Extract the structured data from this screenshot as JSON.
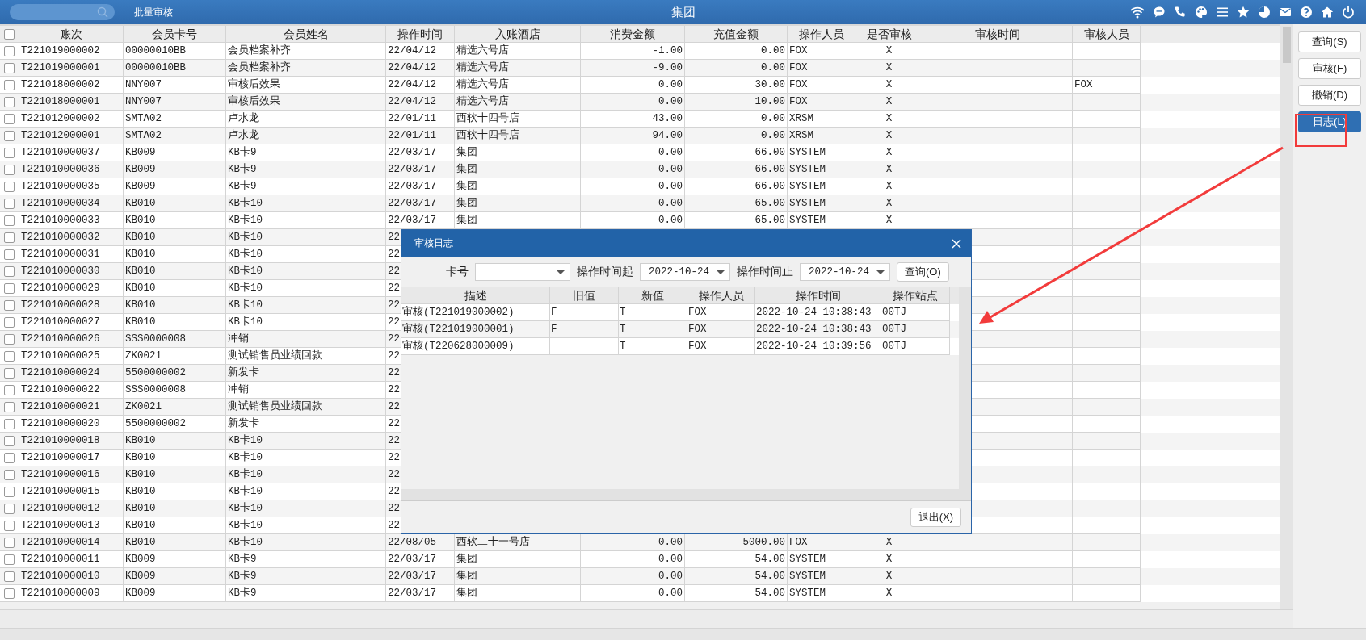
{
  "top_bar": {
    "module_label": "批量审核",
    "title": "集团"
  },
  "table": {
    "header_checkbox": {
      "checked": false
    },
    "columns": [
      "账次",
      "会员卡号",
      "会员姓名",
      "操作时间",
      "入账酒店",
      "消费金额",
      "充值金额",
      "操作人员",
      "是否审核",
      "审核时间",
      "审核人员"
    ],
    "rows": [
      {
        "checked": false,
        "cells": [
          "T221019000002",
          "00000010BB",
          "会员档案补齐",
          "22/04/12",
          "精选六号店",
          "-1.00",
          "0.00",
          "FOX",
          "X"
        ]
      },
      {
        "checked": false,
        "cells": [
          "T221019000001",
          "00000010BB",
          "会员档案补齐",
          "22/04/12",
          "精选六号店",
          "-9.00",
          "0.00",
          "FOX",
          "X"
        ]
      },
      {
        "checked": false,
        "cells": [
          "T221018000002",
          "NNY007",
          "审核后效果",
          "22/04/12",
          "精选六号店",
          "0.00",
          "30.00",
          "FOX",
          "X",
          null,
          "FOX"
        ]
      },
      {
        "checked": false,
        "cells": [
          "T221018000001",
          "NNY007",
          "审核后效果",
          "22/04/12",
          "精选六号店",
          "0.00",
          "10.00",
          "FOX",
          "X"
        ]
      },
      {
        "checked": false,
        "cells": [
          "T221012000002",
          "SMTA02",
          "卢水龙",
          "22/01/11",
          "西软十四号店",
          "43.00",
          "0.00",
          "XRSM",
          "X"
        ]
      },
      {
        "checked": false,
        "cells": [
          "T221012000001",
          "SMTA02",
          "卢水龙",
          "22/01/11",
          "西软十四号店",
          "94.00",
          "0.00",
          "XRSM",
          "X"
        ]
      },
      {
        "checked": false,
        "cells": [
          "T221010000037",
          "KB009",
          "KB卡9",
          "22/03/17",
          "集团",
          "0.00",
          "66.00",
          "SYSTEM",
          "X"
        ]
      },
      {
        "checked": false,
        "cells": [
          "T221010000036",
          "KB009",
          "KB卡9",
          "22/03/17",
          "集团",
          "0.00",
          "66.00",
          "SYSTEM",
          "X"
        ]
      },
      {
        "checked": false,
        "cells": [
          "T221010000035",
          "KB009",
          "KB卡9",
          "22/03/17",
          "集团",
          "0.00",
          "66.00",
          "SYSTEM",
          "X"
        ]
      },
      {
        "checked": false,
        "cells": [
          "T221010000034",
          "KB010",
          "KB卡10",
          "22/03/17",
          "集团",
          "0.00",
          "65.00",
          "SYSTEM",
          "X"
        ]
      },
      {
        "checked": false,
        "cells": [
          "T221010000033",
          "KB010",
          "KB卡10",
          "22/03/17",
          "集团",
          "0.00",
          "65.00",
          "SYSTEM",
          "X"
        ]
      },
      {
        "checked": false,
        "cells": [
          "T221010000032",
          "KB010",
          "KB卡10",
          "22"
        ]
      },
      {
        "checked": false,
        "cells": [
          "T221010000031",
          "KB010",
          "KB卡10",
          "22"
        ]
      },
      {
        "checked": false,
        "cells": [
          "T221010000030",
          "KB010",
          "KB卡10",
          "22"
        ]
      },
      {
        "checked": false,
        "cells": [
          "T221010000029",
          "KB010",
          "KB卡10",
          "22"
        ]
      },
      {
        "checked": false,
        "cells": [
          "T221010000028",
          "KB010",
          "KB卡10",
          "22"
        ]
      },
      {
        "checked": false,
        "cells": [
          "T221010000027",
          "KB010",
          "KB卡10",
          "22"
        ]
      },
      {
        "checked": false,
        "cells": [
          "T221010000026",
          "SSS0000008",
          "冲销",
          "22"
        ]
      },
      {
        "checked": false,
        "cells": [
          "T221010000025",
          "ZK0021",
          "测试销售员业绩回款",
          "22"
        ]
      },
      {
        "checked": false,
        "cells": [
          "T221010000024",
          "5500000002",
          "新发卡",
          "22"
        ]
      },
      {
        "checked": false,
        "cells": [
          "T221010000022",
          "SSS0000008",
          "冲销",
          "22"
        ]
      },
      {
        "checked": false,
        "cells": [
          "T221010000021",
          "ZK0021",
          "测试销售员业绩回款",
          "22"
        ]
      },
      {
        "checked": false,
        "cells": [
          "T221010000020",
          "5500000002",
          "新发卡",
          "22"
        ]
      },
      {
        "checked": false,
        "cells": [
          "T221010000018",
          "KB010",
          "KB卡10",
          "22"
        ]
      },
      {
        "checked": false,
        "cells": [
          "T221010000017",
          "KB010",
          "KB卡10",
          "22"
        ]
      },
      {
        "checked": false,
        "cells": [
          "T221010000016",
          "KB010",
          "KB卡10",
          "22"
        ]
      },
      {
        "checked": false,
        "cells": [
          "T221010000015",
          "KB010",
          "KB卡10",
          "22"
        ]
      },
      {
        "checked": false,
        "cells": [
          "T221010000012",
          "KB010",
          "KB卡10",
          "22"
        ]
      },
      {
        "checked": false,
        "cells": [
          "T221010000013",
          "KB010",
          "KB卡10",
          "22"
        ]
      },
      {
        "checked": false,
        "cells": [
          "T221010000014",
          "KB010",
          "KB卡10",
          "22/08/05",
          "西软二十一号店",
          "0.00",
          "5000.00",
          "FOX",
          "X"
        ]
      },
      {
        "checked": false,
        "cells": [
          "T221010000011",
          "KB009",
          "KB卡9",
          "22/03/17",
          "集团",
          "0.00",
          "54.00",
          "SYSTEM",
          "X"
        ]
      },
      {
        "checked": false,
        "cells": [
          "T221010000010",
          "KB009",
          "KB卡9",
          "22/03/17",
          "集团",
          "0.00",
          "54.00",
          "SYSTEM",
          "X"
        ]
      },
      {
        "checked": false,
        "cells": [
          "T221010000009",
          "KB009",
          "KB卡9",
          "22/03/17",
          "集团",
          "0.00",
          "54.00",
          "SYSTEM",
          "X"
        ]
      }
    ]
  },
  "side_buttons": [
    {
      "label": "查询(S)",
      "selected": false
    },
    {
      "label": "审核(F)",
      "selected": false
    },
    {
      "label": "撤销(D)",
      "selected": false
    },
    {
      "label": "日志(L)",
      "selected": true
    }
  ],
  "dialog": {
    "title": "审核日志",
    "filters": {
      "card_label": "卡号",
      "start_label": "操作时间起",
      "start_value": "2022-10-24",
      "end_label": "操作时间止",
      "end_value": "2022-10-24",
      "query_button": "查询(O)"
    },
    "columns": [
      "描述",
      "旧值",
      "新值",
      "操作人员",
      "操作时间",
      "操作站点"
    ],
    "rows": [
      [
        "审核(T221019000002)",
        "F",
        "T",
        "FOX",
        "2022-10-24 10:38:43",
        "00TJ"
      ],
      [
        "审核(T221019000001)",
        "F",
        "T",
        "FOX",
        "2022-10-24 10:38:43",
        "00TJ"
      ],
      [
        "审核(T220628000009)",
        null,
        "T",
        "FOX",
        "2022-10-24 10:39:56",
        "00TJ"
      ]
    ],
    "exit_button": "退出(X)"
  }
}
